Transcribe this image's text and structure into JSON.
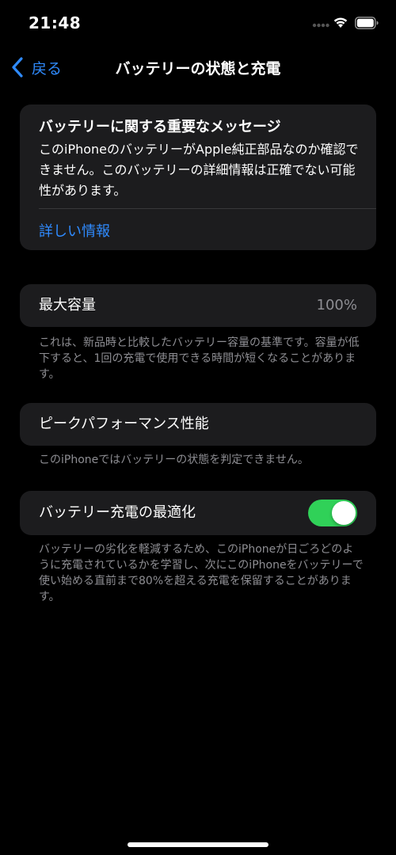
{
  "status_bar": {
    "time": "21:48",
    "icons": [
      "signal-dots-icon",
      "wifi-icon",
      "battery-icon"
    ]
  },
  "nav": {
    "back_label": "戻る",
    "title": "バッテリーの状態と充電"
  },
  "message": {
    "title": "バッテリーに関する重要なメッセージ",
    "body": "このiPhoneのバッテリーがApple純正部品なのか確認できません。このバッテリーの詳細情報は正確でない可能性があります。",
    "link": "詳しい情報"
  },
  "max_capacity": {
    "label": "最大容量",
    "value": "100%",
    "footnote": "これは、新品時と比較したバッテリー容量の基準です。容量が低下すると、1回の充電で使用できる時間が短くなることがあります。"
  },
  "peak_performance": {
    "label": "ピークパフォーマンス性能",
    "footnote": "このiPhoneではバッテリーの状態を判定できません。"
  },
  "optimized_charging": {
    "label": "バッテリー充電の最適化",
    "enabled": true,
    "footnote": "バッテリーの劣化を軽減するため、このiPhoneが日ごろどのように充電されているかを学習し、次にこのiPhoneをバッテリーで使い始める直前まで80%を超える充電を保留することがあります。"
  },
  "colors": {
    "background": "#000000",
    "card": "#1c1c1e",
    "accent_blue": "#2f8bff",
    "toggle_on": "#30d158",
    "secondary_text": "#8e8e93"
  }
}
